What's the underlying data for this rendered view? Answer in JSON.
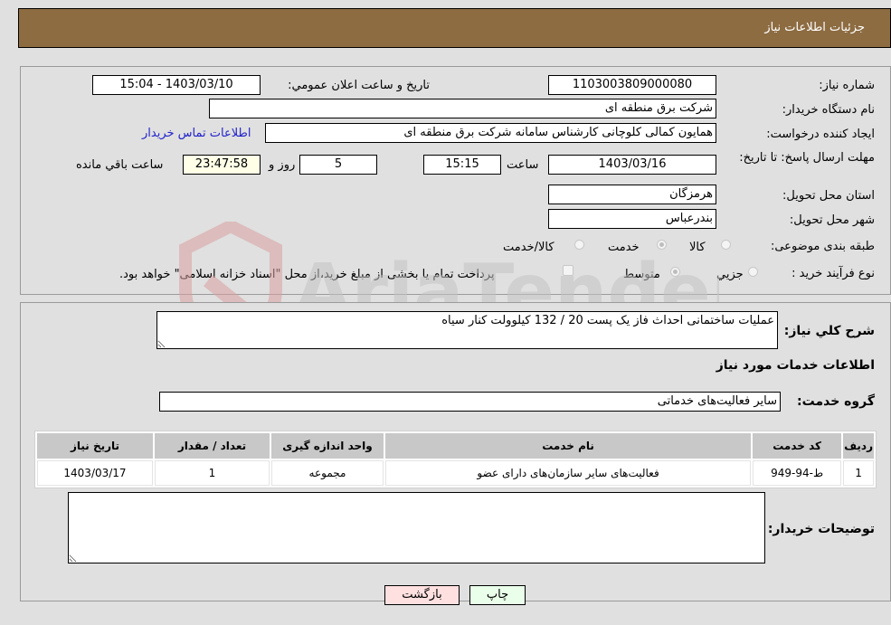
{
  "header": {
    "title": "جزئیات اطلاعات نیاز"
  },
  "fields": {
    "need_number": {
      "label": "شماره نیاز:",
      "value": "1103003809000080"
    },
    "announce_datetime": {
      "label": "تاریخ و ساعت اعلان عمومي:",
      "value": "1403/03/10 - 15:04"
    },
    "buyer_org": {
      "label": "نام دستگاه خريدار:",
      "value": "شرکت برق منطقه ای"
    },
    "requester": {
      "label": "ایجاد کننده درخواست:",
      "value": "همایون کمالی کلوچانی کارشناس سامانه شرکت برق منطقه ای"
    },
    "buyer_contact_link": "اطلاعات تماس خریدار",
    "deadline": {
      "label": "مهلت ارسال پاسخ: تا تاریخ:",
      "date": "1403/03/16",
      "time_label": "ساعت",
      "time": "15:15",
      "days": "5",
      "days_label": "روز و",
      "remaining": "23:47:58",
      "remaining_label": "ساعت باقي مانده"
    },
    "province": {
      "label": "استان محل تحویل:",
      "value": "هرمزگان"
    },
    "city": {
      "label": "شهر محل تحویل:",
      "value": "بندرعباس"
    },
    "category": {
      "label": "طبقه بندی موضوعی:",
      "options": [
        "کالا",
        "خدمت",
        "کالا/خدمت"
      ],
      "selected": "خدمت"
    },
    "purchase_type": {
      "label": "نوع فرآیند خرید :",
      "options": [
        "جزيي",
        "متوسط"
      ],
      "selected": "متوسط",
      "treasury_note": "پرداخت تمام یا بخشی از مبلغ خرید،از محل \"اسناد خزانه اسلامی\" خواهد بود."
    }
  },
  "description": {
    "label": "شرح کلي نياز:",
    "value": "عملیات ساختمانی احداث فاز یک پست 20 / 132 کیلوولت کنار سیاه"
  },
  "services_section": {
    "title": "اطلاعات خدمات مورد نیاز",
    "group_label": "گروه خدمت:",
    "group_value": "سایر فعالیت‌های خدماتی"
  },
  "table": {
    "headers": [
      "رديف",
      "کد خدمت",
      "نام خدمت",
      "واحد اندازه گیری",
      "تعداد / مقدار",
      "تاریخ نیاز"
    ],
    "rows": [
      [
        "1",
        "ط-94-949",
        "فعالیت‌های سایر سازمان‌های دارای عضو",
        "مجموعه",
        "1",
        "1403/03/17"
      ]
    ]
  },
  "buyer_notes": {
    "label": "توضیحات خریدار:",
    "value": ""
  },
  "buttons": {
    "print": "چاپ",
    "back": "بازگشت"
  },
  "watermark": {
    "text": "AriaTender.neT"
  },
  "colors": {
    "header_bg": "#8d6c42",
    "print_btn_bg": "#eaffea",
    "back_btn_bg": "#ffe0e0",
    "link": "#2222cc"
  }
}
